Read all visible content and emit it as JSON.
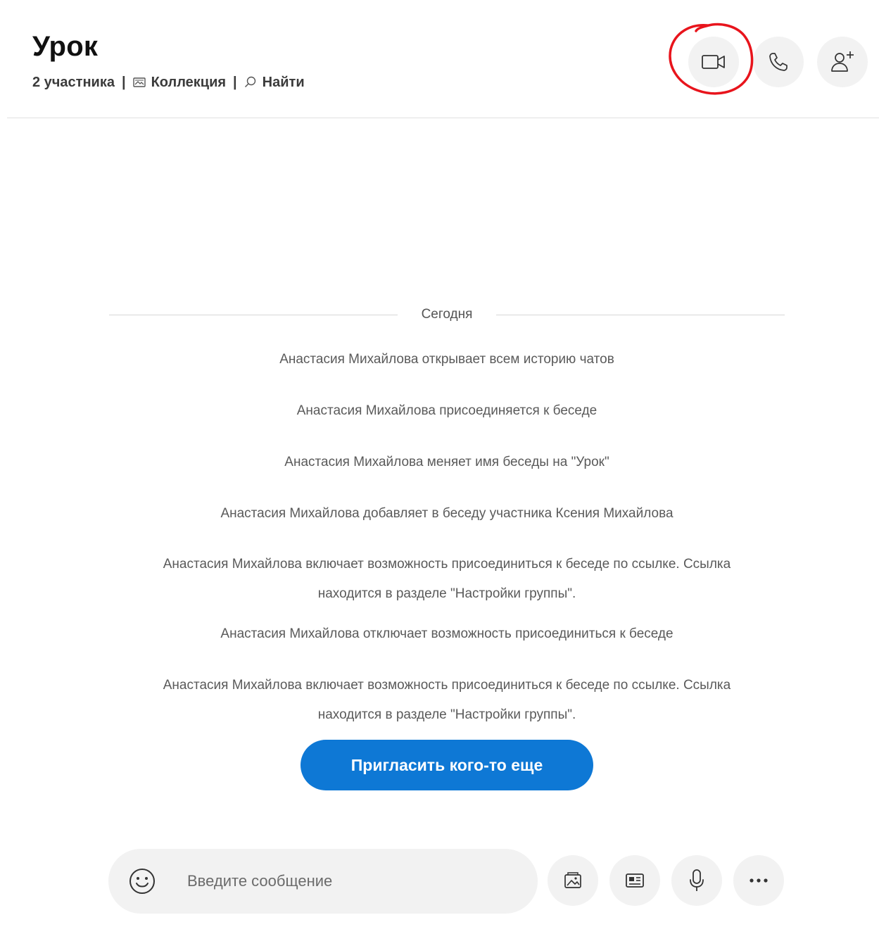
{
  "header": {
    "title": "Урок",
    "participants": "2 участника",
    "separator": "|",
    "collection_label": "Коллекция",
    "find_label": "Найти"
  },
  "header_actions": [
    {
      "name": "video-call-button",
      "icon": "video-camera-icon"
    },
    {
      "name": "audio-call-button",
      "icon": "phone-icon"
    },
    {
      "name": "add-participant-button",
      "icon": "person-add-icon"
    }
  ],
  "annotation": {
    "shape": "hand-drawn circle",
    "color": "#e8141c",
    "target": "video-call-button"
  },
  "chat": {
    "date_divider": "Сегодня",
    "system_messages": [
      "Анастасия Михайлова открывает всем историю чатов",
      "Анастасия Михайлова присоединяется к беседе",
      "Анастасия Михайлова меняет имя беседы на \"Урок\"",
      "Анастасия Михайлова добавляет в беседу участника Ксения Михайлова",
      "Анастасия Михайлова включает возможность присоединиться к беседе по ссылке. Ссылка",
      "находится в разделе \"Настройки группы\".",
      "Анастасия Михайлова отключает возможность присоединиться к беседе",
      "Анастасия Михайлова включает возможность присоединиться к беседе по ссылке. Ссылка",
      "находится в разделе \"Настройки группы\"."
    ],
    "invite_button": "Пригласить кого-то еще"
  },
  "composer": {
    "placeholder": "Введите сообщение",
    "emoji_icon": "smiley-icon",
    "actions": [
      "media-gallery-icon",
      "contact-card-icon",
      "microphone-icon",
      "more-icon"
    ]
  },
  "colors": {
    "accent": "#0e78d5",
    "button_bg": "#f2f2f2",
    "annotation_red": "#e8141c",
    "system_text": "#5a5a5a"
  }
}
